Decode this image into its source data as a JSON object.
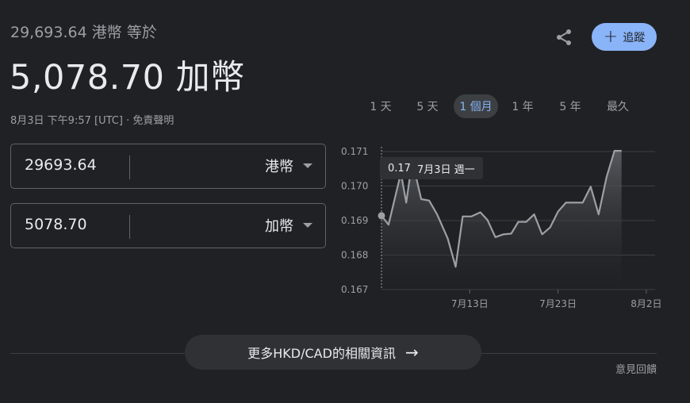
{
  "header": {
    "from_amount_text": "29,693.64",
    "from_currency_text": "港幣",
    "equals_text": "等於",
    "result_amount_text": "5,078.70",
    "result_currency_text": "加幣",
    "datetime": "8月3日 下午9:57 [UTC]",
    "separator": "·",
    "disclaimer_link": "免責聲明"
  },
  "actions": {
    "share_icon": "share-icon",
    "track_label": "追蹤",
    "track_icon": "+"
  },
  "converter": {
    "from": {
      "value": "29693.64",
      "currency": "港幣"
    },
    "to": {
      "value": "5078.70",
      "currency": "加幣"
    }
  },
  "range_tabs": [
    {
      "label": "1 天",
      "active": false
    },
    {
      "label": "5 天",
      "active": false
    },
    {
      "label": "1 個月",
      "active": true
    },
    {
      "label": "1 年",
      "active": false
    },
    {
      "label": "5 年",
      "active": false
    },
    {
      "label": "最久",
      "active": false
    }
  ],
  "tooltip": {
    "value": "0.17",
    "date": "7月3日 週一"
  },
  "chart_data": {
    "type": "area",
    "ylim": [
      0.167,
      0.171
    ],
    "yticks": [
      "0.171",
      "0.170",
      "0.169",
      "0.168",
      "0.167"
    ],
    "xlabels": [
      {
        "label": "7月13日",
        "day": 10
      },
      {
        "label": "7月23日",
        "day": 20
      },
      {
        "label": "8月2日",
        "day": 30
      }
    ],
    "xlim": [
      0,
      31
    ],
    "grid": true,
    "colors": {
      "line": "#9aa0a6",
      "grid": "#3c4043",
      "fill_top": "#5f6368"
    },
    "series": [
      {
        "points": [
          [
            0,
            0.16914
          ],
          [
            0.8,
            0.16888
          ],
          [
            2.2,
            0.17038
          ],
          [
            2.8,
            0.16952
          ],
          [
            3.4,
            0.17058
          ],
          [
            3.9,
            0.17028
          ],
          [
            4.5,
            0.16962
          ],
          [
            5.4,
            0.16958
          ],
          [
            6.3,
            0.16918
          ],
          [
            7.5,
            0.16848
          ],
          [
            8.4,
            0.16766
          ],
          [
            9.2,
            0.16912
          ],
          [
            10.2,
            0.16912
          ],
          [
            11.2,
            0.16924
          ],
          [
            12.0,
            0.16902
          ],
          [
            12.9,
            0.16852
          ],
          [
            13.8,
            0.1686
          ],
          [
            14.7,
            0.16862
          ],
          [
            15.5,
            0.16896
          ],
          [
            16.4,
            0.16896
          ],
          [
            17.3,
            0.16918
          ],
          [
            18.2,
            0.1686
          ],
          [
            19.1,
            0.1688
          ],
          [
            20.0,
            0.16926
          ],
          [
            20.9,
            0.16952
          ],
          [
            21.8,
            0.16952
          ],
          [
            22.8,
            0.16952
          ],
          [
            23.7,
            0.16998
          ],
          [
            24.6,
            0.16918
          ],
          [
            25.5,
            0.17026
          ],
          [
            26.4,
            0.17102
          ],
          [
            27.2,
            0.17102
          ]
        ]
      }
    ]
  },
  "footer": {
    "more_label": "更多HKD/CAD的相關資訊",
    "more_arrow": "→",
    "feedback": "意見回饋"
  }
}
